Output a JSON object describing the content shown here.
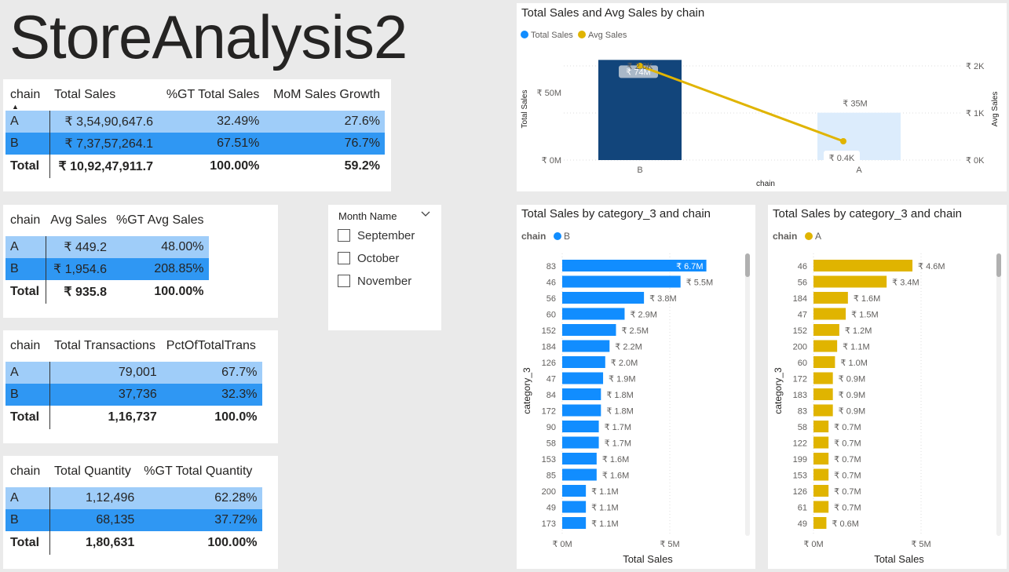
{
  "page_title": "StoreAnalysis2",
  "table1": {
    "headers": [
      "chain",
      "Total Sales",
      "%GT Total Sales",
      "MoM Sales Growth"
    ],
    "rows": [
      [
        "A",
        "₹ 3,54,90,647.6",
        "32.49%",
        "27.6%"
      ],
      [
        "B",
        "₹ 7,37,57,264.1",
        "67.51%",
        "76.7%"
      ]
    ],
    "total": [
      "Total",
      "₹ 10,92,47,911.7",
      "100.00%",
      "59.2%"
    ]
  },
  "table2": {
    "headers": [
      "chain",
      "Avg Sales",
      "%GT Avg Sales"
    ],
    "rows": [
      [
        "A",
        "₹ 449.2",
        "48.00%"
      ],
      [
        "B",
        "₹ 1,954.6",
        "208.85%"
      ]
    ],
    "total": [
      "Total",
      "₹ 935.8",
      "100.00%"
    ]
  },
  "table3": {
    "headers": [
      "chain",
      "Total Transactions",
      "PctOfTotalTrans"
    ],
    "rows": [
      [
        "A",
        "79,001",
        "67.7%"
      ],
      [
        "B",
        "37,736",
        "32.3%"
      ]
    ],
    "total": [
      "Total",
      "1,16,737",
      "100.0%"
    ]
  },
  "table4": {
    "headers": [
      "chain",
      "Total Quantity",
      "%GT Total Quantity"
    ],
    "rows": [
      [
        "A",
        "1,12,496",
        "62.28%"
      ],
      [
        "B",
        "68,135",
        "37.72%"
      ]
    ],
    "total": [
      "Total",
      "1,80,631",
      "100.00%"
    ]
  },
  "slicer": {
    "title": "Month Name",
    "options": [
      "September",
      "October",
      "November"
    ]
  },
  "combo_chart": {
    "title": "Total Sales and Avg Sales by chain",
    "legend": [
      "Total Sales",
      "Avg Sales"
    ],
    "x_axis_title": "chain",
    "y_left_title": "Total Sales",
    "y_right_title": "Avg Sales",
    "y_left_ticks": [
      "₹ 0M",
      "₹ 50M"
    ],
    "y_right_ticks": [
      "₹ 0K",
      "₹ 1K",
      "₹ 2K"
    ],
    "bar_labels": [
      "₹ 74M",
      "₹ 35M"
    ],
    "line_labels": [
      "₹ 2.0K",
      "₹ 0.4K"
    ]
  },
  "bar_chart_b": {
    "title": "Total Sales by category_3 and chain",
    "legend_title": "chain",
    "legend_item": "B",
    "y_axis_title": "category_3",
    "x_axis_title": "Total Sales",
    "x_ticks": [
      "₹ 0M",
      "₹ 5M"
    ],
    "labels": [
      "₹ 6.7M",
      "₹ 5.5M",
      "₹ 3.8M",
      "₹ 2.9M",
      "₹ 2.5M",
      "₹ 2.2M",
      "₹ 2.0M",
      "₹ 1.9M",
      "₹ 1.8M",
      "₹ 1.8M",
      "₹ 1.7M",
      "₹ 1.7M",
      "₹ 1.6M",
      "₹ 1.6M",
      "₹ 1.1M",
      "₹ 1.1M",
      "₹ 1.1M"
    ]
  },
  "bar_chart_a": {
    "title": "Total Sales by category_3 and chain",
    "legend_title": "chain",
    "legend_item": "A",
    "y_axis_title": "category_3",
    "x_axis_title": "Total Sales",
    "x_ticks": [
      "₹ 0M",
      "₹ 5M"
    ],
    "labels": [
      "₹ 4.6M",
      "₹ 3.4M",
      "₹ 1.6M",
      "₹ 1.5M",
      "₹ 1.2M",
      "₹ 1.1M",
      "₹ 1.0M",
      "₹ 0.9M",
      "₹ 0.9M",
      "₹ 0.9M",
      "₹ 0.7M",
      "₹ 0.7M",
      "₹ 0.7M",
      "₹ 0.7M",
      "₹ 0.7M",
      "₹ 0.7M",
      "₹ 0.6M"
    ]
  },
  "colors": {
    "series_b": "#118dff",
    "series_a_bar": "#e0b400",
    "combo_bar_b": "#12457b",
    "combo_bar_a": "#dcecfc",
    "row_a": "#9fcdf9",
    "row_b": "#2f97f3"
  },
  "chart_data": [
    {
      "type": "bar",
      "title": "Total Sales and Avg Sales by chain",
      "categories": [
        "B",
        "A"
      ],
      "series": [
        {
          "name": "Total Sales",
          "values": [
            74,
            35
          ]
        },
        {
          "name": "Avg Sales",
          "values": [
            2.0,
            0.4
          ]
        }
      ],
      "xlabel": "chain",
      "ylabel": "Total Sales",
      "y2label": "Avg Sales",
      "ylim": [
        0,
        80
      ],
      "y2lim": [
        0,
        2.3
      ]
    },
    {
      "type": "bar",
      "title": "Total Sales by category_3 and chain",
      "categories": [
        "83",
        "46",
        "56",
        "60",
        "152",
        "184",
        "126",
        "47",
        "84",
        "172",
        "90",
        "58",
        "153",
        "85",
        "200",
        "49",
        "173"
      ],
      "series": [
        {
          "name": "B",
          "values": [
            6.7,
            5.5,
            3.8,
            2.9,
            2.5,
            2.2,
            2.0,
            1.9,
            1.8,
            1.8,
            1.7,
            1.7,
            1.6,
            1.6,
            1.1,
            1.1,
            1.1
          ]
        }
      ],
      "xlabel": "Total Sales",
      "ylabel": "category_3",
      "xlim": [
        0,
        7.2
      ]
    },
    {
      "type": "bar",
      "title": "Total Sales by category_3 and chain",
      "categories": [
        "46",
        "56",
        "184",
        "47",
        "152",
        "200",
        "60",
        "172",
        "183",
        "83",
        "58",
        "122",
        "199",
        "153",
        "126",
        "61",
        "49"
      ],
      "series": [
        {
          "name": "A",
          "values": [
            4.6,
            3.4,
            1.6,
            1.5,
            1.2,
            1.1,
            1.0,
            0.9,
            0.9,
            0.9,
            0.7,
            0.7,
            0.7,
            0.7,
            0.7,
            0.7,
            0.6
          ]
        }
      ],
      "xlabel": "Total Sales",
      "ylabel": "category_3",
      "xlim": [
        0,
        7.2
      ]
    }
  ]
}
